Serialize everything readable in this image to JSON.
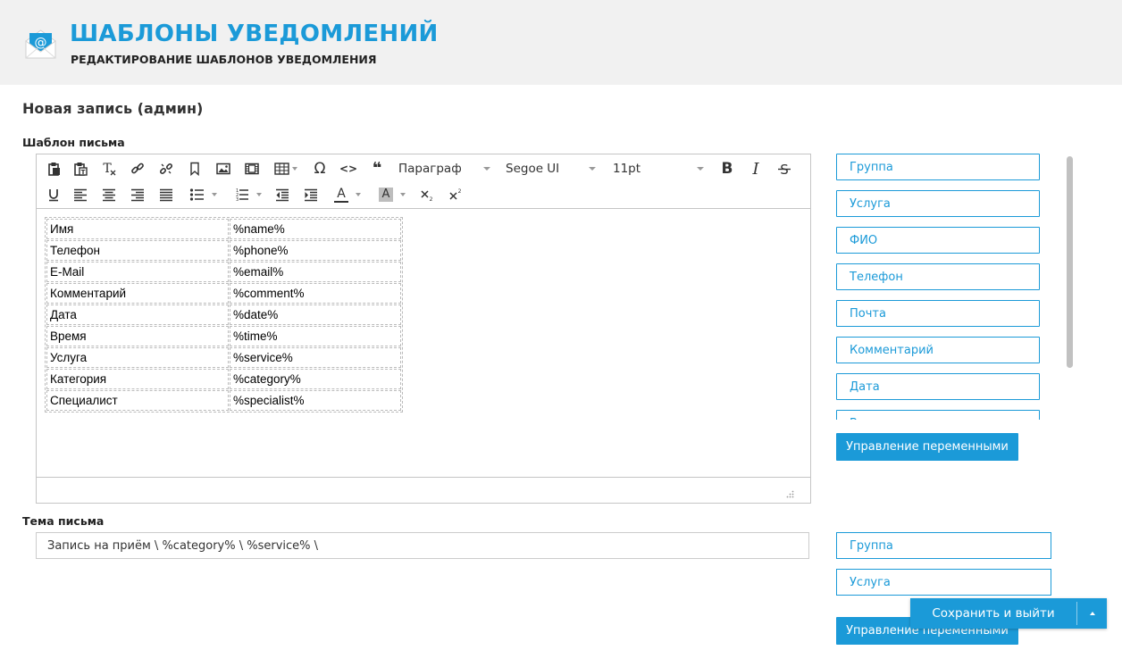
{
  "header": {
    "title": "ШАБЛОНЫ УВЕДОМЛЕНИЙ",
    "subtitle": "РЕДАКТИРОВАНИЕ ШАБЛОНОВ УВЕДОМЛЕНИЯ",
    "icon": "email-at-icon"
  },
  "page": {
    "heading": "Новая запись (админ)"
  },
  "template_field": {
    "label": "Шаблон письма",
    "toolbar": {
      "block_format": "Параграф",
      "font_family": "Segoe UI",
      "font_size": "11pt",
      "bold_label": "B",
      "italic_label": "I",
      "omega_label": "Ω",
      "code_label": "<>",
      "quote_label": "❝",
      "text_color_label": "A",
      "bg_color_label": "A"
    },
    "table": [
      [
        "Имя",
        "%name%"
      ],
      [
        "Телефон",
        "%phone%"
      ],
      [
        "E-Mail",
        "%email%"
      ],
      [
        "Комментарий",
        "%comment%"
      ],
      [
        "Дата",
        "%date%"
      ],
      [
        "Время",
        "%time%"
      ],
      [
        "Услуга",
        "%service%"
      ],
      [
        "Категория",
        "%category%"
      ],
      [
        "Специалист",
        "%specialist%"
      ]
    ],
    "variables": [
      "Группа",
      "Услуга",
      "ФИО",
      "Телефон",
      "Почта",
      "Комментарий",
      "Дата",
      "Время"
    ],
    "manage_button": "Управление переменными"
  },
  "subject_field": {
    "label": "Тема письма",
    "value": "Запись на приём \\ %category% \\ %service% \\",
    "variables": [
      "Группа",
      "Услуга"
    ],
    "manage_button": "Управление переменными"
  },
  "actions": {
    "save_exit": "Сохранить и выйти"
  },
  "colors": {
    "accent": "#1b9ad8",
    "header_bg": "#f1f1f1"
  }
}
